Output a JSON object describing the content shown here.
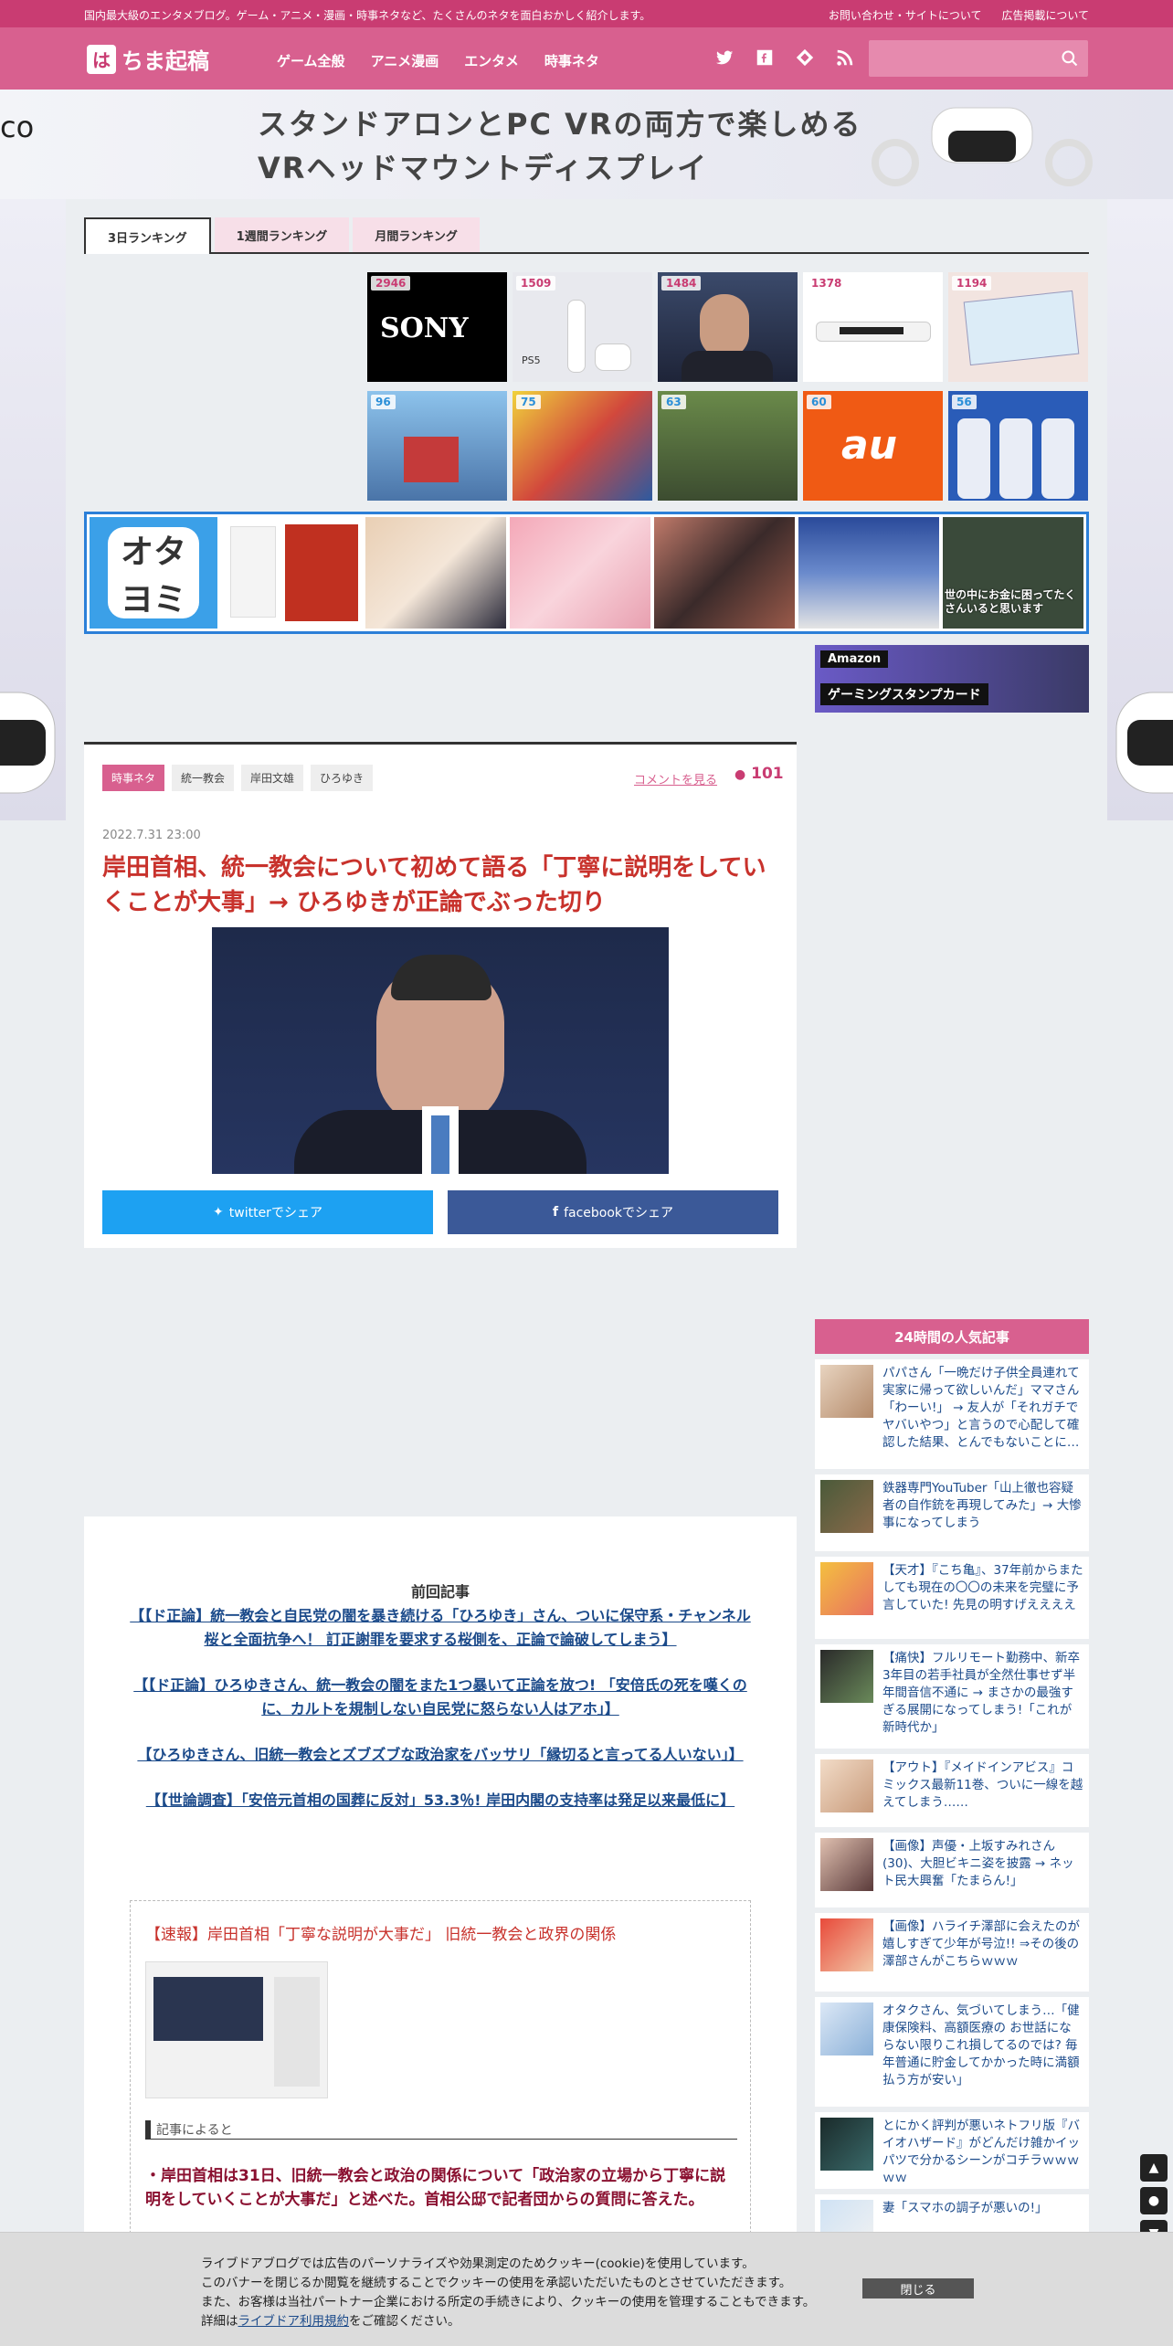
{
  "topbar": {
    "tagline": "国内最大級のエンタメブログ。ゲーム・アニメ・漫画・時事ネタなど、たくさんのネタを面白おかしく紹介します。",
    "link_contact": "お問い合わせ・サイトについて",
    "link_ad": "広告掲載について"
  },
  "header": {
    "logo": "ちま起稿",
    "logo_mark": "は",
    "nav": [
      "ゲーム全般",
      "アニメ漫画",
      "エンタメ",
      "時事ネタ"
    ]
  },
  "banner": {
    "line1": "スタンドアロンとPC VRの両方で楽しめる",
    "line2": "VRヘッドマウントディスプレイ",
    "left_fragment": "co"
  },
  "tabs": [
    "3日ランキング",
    "1週間ランキング",
    "月間ランキング"
  ],
  "ranking_thumbs": {
    "row1": [
      {
        "count": "2946",
        "label": "SONY"
      },
      {
        "count": "1509",
        "label": "PS5"
      },
      {
        "count": "1484",
        "label": ""
      },
      {
        "count": "1378",
        "label": ""
      },
      {
        "count": "1194",
        "label": ""
      }
    ],
    "row2": [
      {
        "count": "96",
        "label": ""
      },
      {
        "count": "75",
        "label": ""
      },
      {
        "count": "63",
        "label": ""
      },
      {
        "count": "60",
        "label": "au"
      },
      {
        "count": "56",
        "label": ""
      }
    ]
  },
  "otayomi": {
    "logo": "オタ\nヨミ",
    "last_caption": "世の中にお金に困ってたくさんいると思います"
  },
  "amazon": {
    "brand": "Amazon",
    "label": "ゲーミングスタンプカード"
  },
  "article": {
    "categories": [
      "時事ネタ",
      "統一教会",
      "岸田文雄",
      "ひろゆき"
    ],
    "comment_link": "コメントを見る",
    "comment_count": "101",
    "date": "2022.7.31 23:00",
    "title": "岸田首相、統一教会について初めて語る「丁寧に説明をしていくことが大事」→ ひろゆきが正論でぶった切り",
    "share_twitter": "twitterでシェア",
    "share_facebook": "facebookでシェア"
  },
  "popular": {
    "heading": "24時間の人気記事",
    "items": [
      "パパさん「一晩だけ子供全員連れて実家に帰って欲しいんだ」ママさん「わーい!」 → 友人が「それガチでヤバいやつ」と言うので心配して確認した結果、とんでもないことに…",
      "鉄器専門YouTuber「山上徹也容疑者の自作銃を再現してみた」→ 大惨事になってしまう",
      "【天才】『こち亀』、37年前からまたしても現在の〇〇の未来を完璧に予言していた! 先見の明すげええええ",
      "【痛快】フルリモート勤務中、新卒3年目の若手社員が全然仕事せず半年間音信不通に → まさかの最強すぎる展開になってしまう!「これが新時代か」",
      "【アウト】『メイドインアビス』コミックス最新11巻、ついに一線を越えてしまう……",
      "【画像】声優・上坂すみれさん(30)、大胆ビキニ姿を披露 → ネット民大興奮「たまらん!」",
      "【画像】ハライチ澤部に会えたのが嬉しすぎて少年が号泣!! ⇒その後の澤部さんがこちらｗｗｗ",
      "オタクさん、気づいてしまう…「健康保険料、高額医療の お世話にならない限りこれ損してるのでは? 毎年普通に貯金してかかった時に満額払う方が安い」",
      "とにかく評判が悪いネトフリ版『バイオハザード』がどんだけ雑かイッパツで分かるシーンがコチラｗｗｗｗｗ",
      "妻「スマホの調子が悪いの!」"
    ]
  },
  "previous": {
    "heading": "前回記事",
    "links": [
      "【【ド正論】統一教会と自民党の闇を暴き続ける「ひろゆき」さん、ついに保守系・チャンネル桜と全面抗争へ！ 訂正謝罪を要求する桜側を、正論で論破してしまう】",
      "【【ド正論】ひろゆきさん、統一教会の闇をまた1つ暴いて正論を放つ! 「安倍氏の死を嘆くのに、カルトを規制しない自民党に怒らない人はアホ」】",
      "【ひろゆきさん、旧統一教会とズブズブな政治家をバッサリ「縁切ると言ってる人いない」】",
      "【【世論調査】「安倍元首相の国葬に反対」53.3％! 岸田内閣の支持率は発足以来最低に】"
    ]
  },
  "quote": {
    "title": "【速報】岸田首相「丁寧な説明が大事だ」 旧統一教会と政界の関係",
    "subheading": "記事によると",
    "body": "・岸田首相は31日、旧統一教会と政治の関係について「政治家の立場から丁寧に説明をしていくことが大事だ」と述べた。首相公邸で記者団からの質問に答えた。"
  },
  "cookie": {
    "line1": "ライブドアブログでは広告のパーソナライズや効果測定のためクッキー(cookie)を使用しています。",
    "line2": "このバナーを閉じるか閲覧を継続することでクッキーの使用を承認いただいたものとさせていただきます。",
    "line3": "また、お客様は当社パートナー企業における所定の手続きにより、クッキーの使用を管理することもできます。",
    "line4_prefix": "詳細は",
    "line4_link": "ライブドア利用規約",
    "line4_suffix": "をご確認ください。",
    "close": "閉じる"
  },
  "colors": {
    "brand": "#d8608f",
    "topbar": "#c93c72",
    "headline": "#c8322c",
    "twitter": "#1da1f2",
    "facebook": "#3b5998"
  }
}
